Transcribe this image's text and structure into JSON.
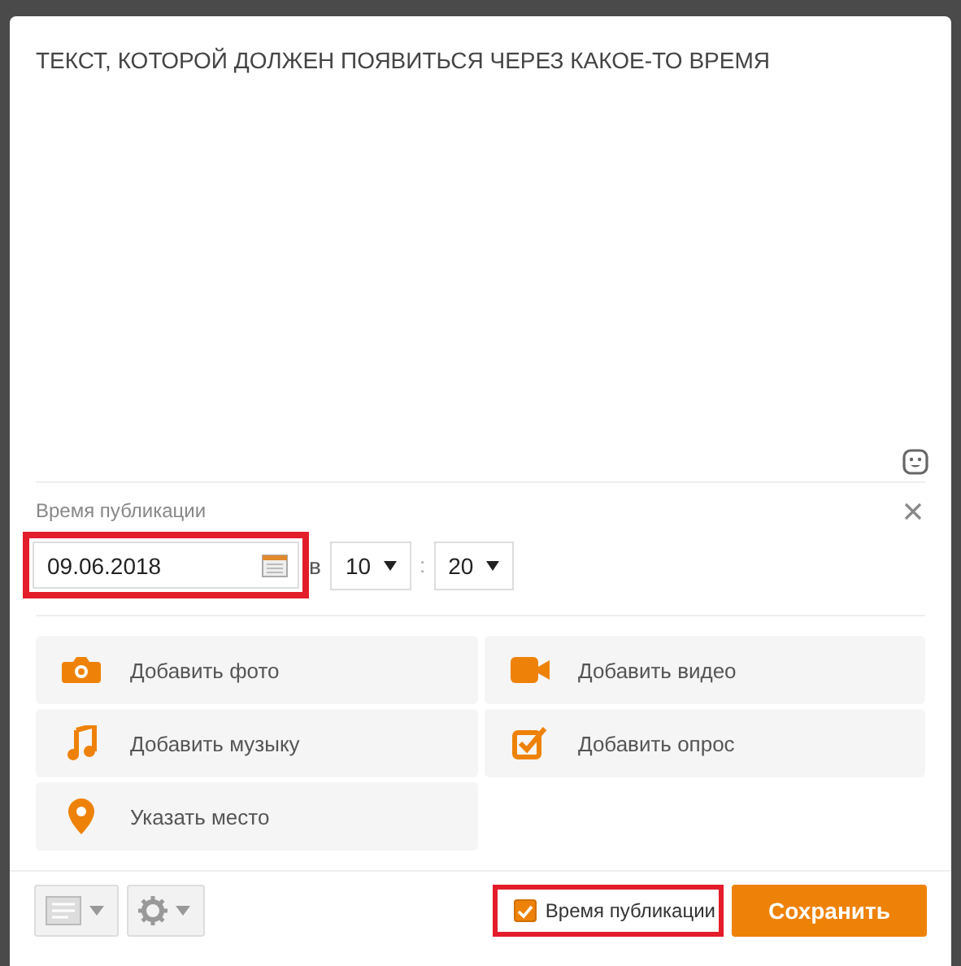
{
  "post": {
    "text": "ТЕКСТ, КОТОРОЙ ДОЛЖЕН ПОЯВИТЬСЯ ЧЕРЕЗ КАКОЕ-ТО ВРЕМЯ"
  },
  "schedule": {
    "label": "Время публикации",
    "date": "09.06.2018",
    "highlighted": true,
    "at": "в",
    "hour": "10",
    "separator": ":",
    "minute": "20"
  },
  "attachments": [
    {
      "kind": "photo",
      "label": "Добавить фото"
    },
    {
      "kind": "video",
      "label": "Добавить видео"
    },
    {
      "kind": "music",
      "label": "Добавить музыку"
    },
    {
      "kind": "poll",
      "label": "Добавить опрос"
    },
    {
      "kind": "place",
      "label": "Указать место"
    }
  ],
  "footer": {
    "schedule_toggle": {
      "label": "Время публикации",
      "checked": true,
      "highlighted": true
    },
    "save": "Сохранить"
  }
}
